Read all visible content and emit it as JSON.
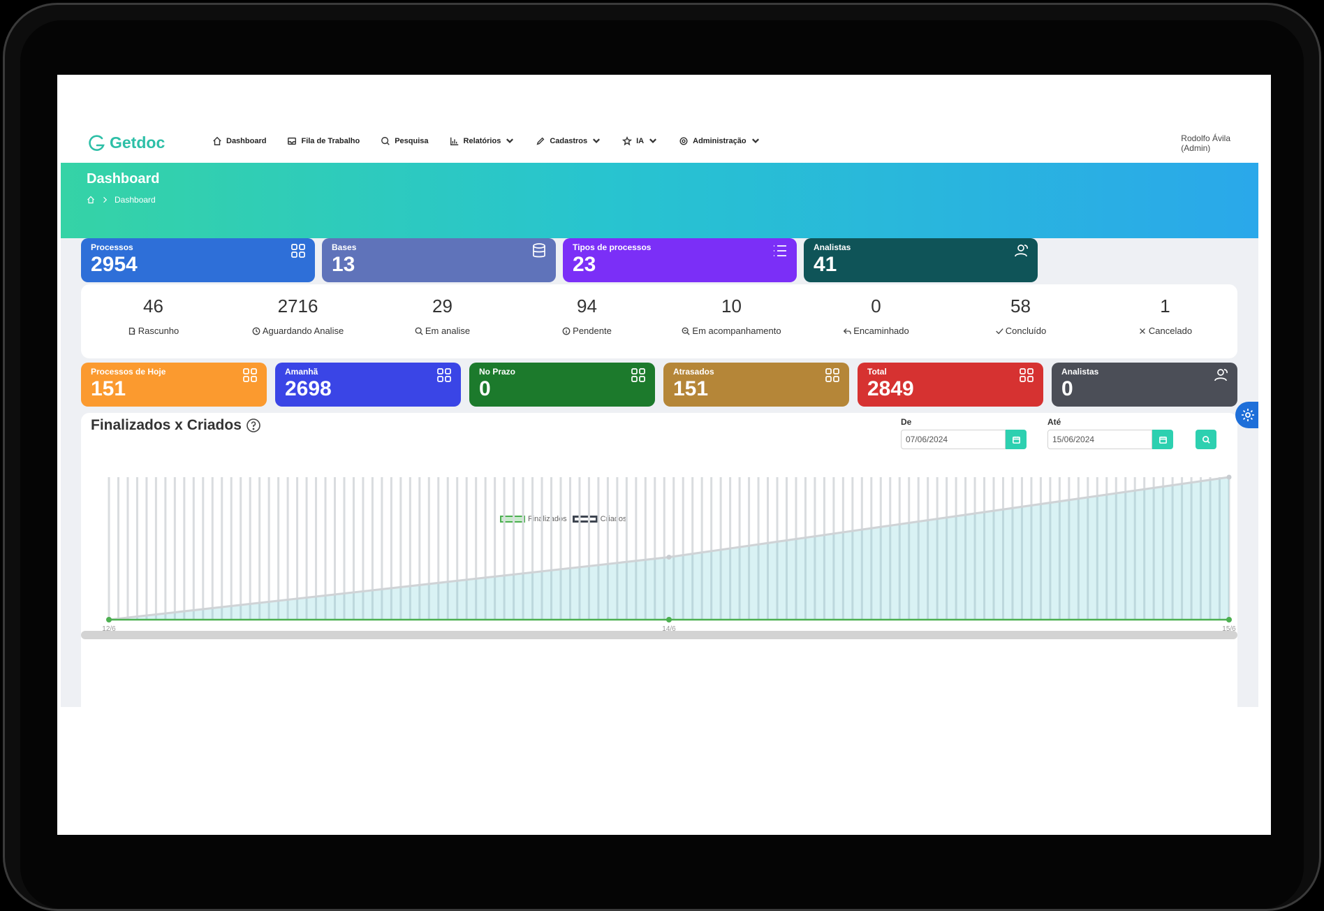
{
  "app": {
    "logo_text": "Getdoc",
    "user": {
      "name": "Rodolfo Ávila",
      "role": "(Admin)"
    },
    "nav": [
      {
        "label": "Dashboard",
        "icon": "home-icon",
        "dropdown": false
      },
      {
        "label": "Fila de Trabalho",
        "icon": "inbox-icon",
        "dropdown": false
      },
      {
        "label": "Pesquisa",
        "icon": "search-icon",
        "dropdown": false
      },
      {
        "label": "Relatórios",
        "icon": "bar-chart-icon",
        "dropdown": true
      },
      {
        "label": "Cadastros",
        "icon": "pencil-icon",
        "dropdown": true
      },
      {
        "label": "IA",
        "icon": "star-icon",
        "dropdown": true
      },
      {
        "label": "Administração",
        "icon": "gear-icon",
        "dropdown": true
      }
    ]
  },
  "hero": {
    "title": "Dashboard",
    "breadcrumb": "Dashboard"
  },
  "top_cards": [
    {
      "label": "Processos",
      "value": "2954",
      "color": "#2e6fd8",
      "icon": "grid-icon"
    },
    {
      "label": "Bases",
      "value": "13",
      "color": "#5f73ba",
      "icon": "database-icon"
    },
    {
      "label": "Tipos de processos",
      "value": "23",
      "color": "#7b2ff7",
      "icon": "list-icon"
    },
    {
      "label": "Analistas",
      "value": "41",
      "color": "#0f5458",
      "icon": "users-icon"
    }
  ],
  "statuses": [
    {
      "value": "46",
      "label": "Rascunho",
      "icon": "draft-icon"
    },
    {
      "value": "2716",
      "label": "Aguardando Analise",
      "icon": "clock-icon"
    },
    {
      "value": "29",
      "label": "Em analise",
      "icon": "search-icon"
    },
    {
      "value": "94",
      "label": "Pendente",
      "icon": "info-icon"
    },
    {
      "value": "10",
      "label": "Em acompanhamento",
      "icon": "zoom-icon"
    },
    {
      "value": "0",
      "label": "Encaminhado",
      "icon": "reply-icon"
    },
    {
      "value": "58",
      "label": "Concluído",
      "icon": "check-icon"
    },
    {
      "value": "1",
      "label": "Cancelado",
      "icon": "x-icon"
    }
  ],
  "bottom_cards": [
    {
      "label": "Processos de Hoje",
      "value": "151",
      "color": "#fb9a2f",
      "icon": "grid-icon"
    },
    {
      "label": "Amanhã",
      "value": "2698",
      "color": "#3a45e6",
      "icon": "grid-icon"
    },
    {
      "label": "No Prazo",
      "value": "0",
      "color": "#1c7a2c",
      "icon": "grid-icon"
    },
    {
      "label": "Atrasados",
      "value": "151",
      "color": "#b58638",
      "icon": "grid-icon"
    },
    {
      "label": "Total",
      "value": "2849",
      "color": "#d63231",
      "icon": "grid-icon"
    },
    {
      "label": "Analistas",
      "value": "0",
      "color": "#4b4e57",
      "icon": "users-icon"
    }
  ],
  "chart_panel": {
    "title": "Finalizados x Criados",
    "from_label": "De",
    "from_value": "07/06/2024",
    "to_label": "Até",
    "to_value": "15/06/2024"
  },
  "chart_data": {
    "type": "area",
    "x": [
      "12/6",
      "14/6",
      "15/6"
    ],
    "series": [
      {
        "name": "Finalizados",
        "values": [
          0,
          0,
          0
        ],
        "color": "#4caf50"
      },
      {
        "name": "Criados",
        "values": [
          0,
          1250,
          2849
        ],
        "color": "#cfd3d6"
      }
    ],
    "xlabel": "",
    "ylabel": "",
    "legend": "top-center",
    "grid": false
  }
}
